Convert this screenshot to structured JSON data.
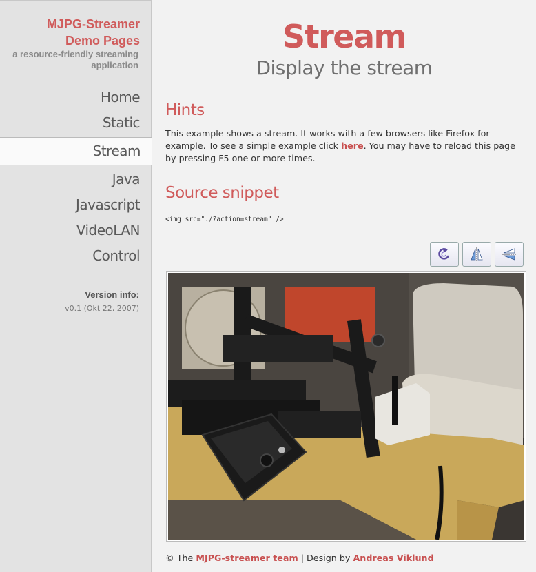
{
  "sidebar": {
    "title_line1": "MJPG-Streamer",
    "title_line2": "Demo Pages",
    "tagline_line1": "a resource-friendly streaming",
    "tagline_line2": "application",
    "nav": [
      "Home",
      "Static",
      "Stream",
      "Java",
      "Javascript",
      "VideoLAN",
      "Control"
    ],
    "active": "Stream",
    "version_label": "Version info:",
    "version_value": "v0.1 (Okt 22, 2007)"
  },
  "main": {
    "title": "Stream",
    "subtitle": "Display the stream",
    "hints_heading": "Hints",
    "hints_text_before": "This example shows a stream. It works with a few browsers like Firefox for example. To see a simple example click ",
    "hints_link": "here",
    "hints_text_after": ". You may have to reload this page by pressing F5 one or more times.",
    "source_heading": "Source snippet",
    "snippet": "<img src=\"./?action=stream\" />",
    "toolbar": [
      "rotate-icon",
      "flip-vertical-icon",
      "flip-horizontal-icon"
    ],
    "footer_prefix": "© The ",
    "footer_team": "MJPG-streamer team",
    "footer_sep": " | Design by ",
    "footer_designer": "Andreas Viklund"
  },
  "colors": {
    "accent": "#d05b5b",
    "sidebar_bg": "#e3e3e3",
    "page_bg": "#f2f2f2"
  }
}
